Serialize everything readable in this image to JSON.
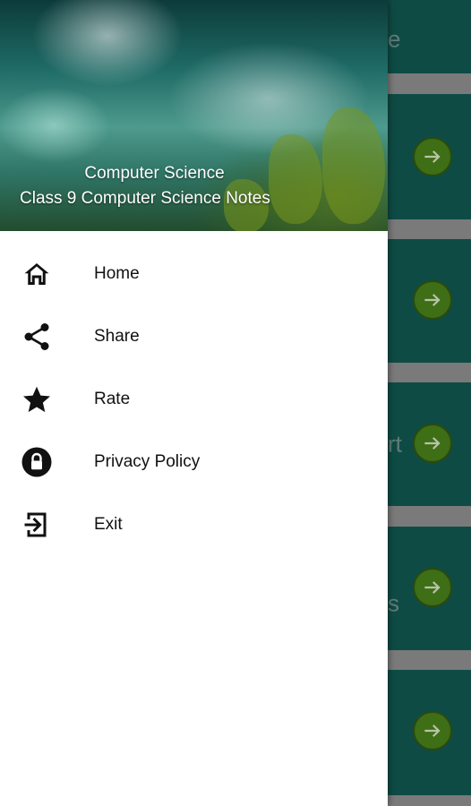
{
  "drawer": {
    "header_title": "Computer Science",
    "header_subtitle": "Class 9 Computer Science Notes",
    "items": [
      {
        "label": "Home",
        "icon": "home-icon"
      },
      {
        "label": "Share",
        "icon": "share-icon"
      },
      {
        "label": "Rate",
        "icon": "star-icon"
      },
      {
        "label": "Privacy Policy",
        "icon": "lock-icon"
      },
      {
        "label": "Exit",
        "icon": "exit-icon"
      }
    ]
  },
  "background": {
    "cards": [
      {
        "partial_text": "e"
      },
      {
        "partial_text": ""
      },
      {
        "partial_text": ""
      },
      {
        "partial_text": "rt"
      },
      {
        "partial_text": "s"
      },
      {
        "partial_text": ""
      }
    ]
  },
  "colors": {
    "card": "#0f4b45",
    "arrow_button": "#3e6e16"
  }
}
